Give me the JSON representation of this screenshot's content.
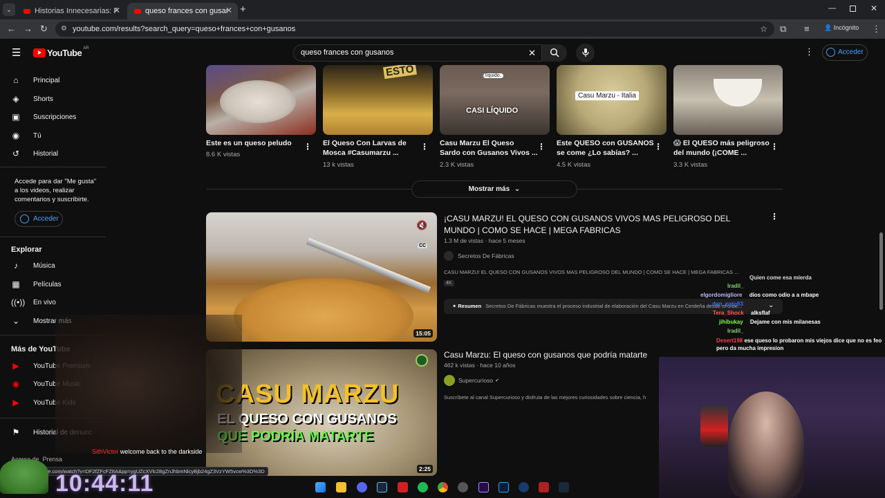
{
  "browser": {
    "tabs": [
      {
        "title": "Historias Innecesarias: Parasitos"
      },
      {
        "title": "queso frances con gusanos - You"
      }
    ],
    "url": "youtube.com/results?search_query=queso+frances+con+gusanos",
    "incognito_label": "Incógnito",
    "status_url": "he.com/watch?v=DF2fZFcFZ8A&pp=ygUZcXVlc28gZnJhbmNlcyBjb24gZ3VzYW5vcw%3D%3D"
  },
  "youtube": {
    "logo_text": "YouTube",
    "region": "AR",
    "search_value": "queso frances con gusanos",
    "sign_in": "Acceder"
  },
  "sidebar": {
    "main_items": [
      {
        "label": "Principal",
        "icon": "home-icon"
      },
      {
        "label": "Shorts",
        "icon": "shorts-icon"
      },
      {
        "label": "Suscripciones",
        "icon": "subscriptions-icon"
      },
      {
        "label": "Tú",
        "icon": "you-icon"
      },
      {
        "label": "Historial",
        "icon": "history-icon"
      }
    ],
    "promo_text": "Accede para dar \"Me gusta\" a los videos, realizar comentarios y suscribirte.",
    "promo_button": "Acceder",
    "explore_heading": "Explorar",
    "explore_items": [
      {
        "label": "Música",
        "icon": "music-icon"
      },
      {
        "label": "Películas",
        "icon": "movies-icon"
      },
      {
        "label": "En vivo",
        "icon": "live-icon"
      },
      {
        "label": "Mostrar más",
        "icon": "chevron-down-icon"
      }
    ],
    "more_heading": "Más de YouTube",
    "more_items": [
      {
        "label": "YouTube Premium"
      },
      {
        "label": "YouTube Music"
      },
      {
        "label": "YouTube Kids"
      }
    ],
    "report_history": "Historial de denunc",
    "footer_links": "Acerca de  Prensa"
  },
  "shorts_row": [
    {
      "title_line1": "Este es un queso peludo",
      "title_line2": "",
      "views": "8.6 K vistas",
      "overlay": ""
    },
    {
      "title_line1": "El Queso Con Larvas de",
      "title_line2": "Mosca #Casumarzu ...",
      "views": "13 k vistas",
      "overlay": "ESTO"
    },
    {
      "title_line1": "Casu Marzu  El Queso",
      "title_line2": "Sardo con Gusanos Vivos ...",
      "views": "2.3 K vistas",
      "overlay": "CASI LÍQUIDO"
    },
    {
      "title_line1": "Este QUESO con GUSANOS",
      "title_line2": "se come ¿Lo sabías? ...",
      "views": "4.5 K vistas",
      "overlay": "Casu Marzu - Italia"
    },
    {
      "title_line1": "😱 El QUESO más peligroso",
      "title_line2": "del mundo (¡COME ...",
      "views": "3.3 K vistas",
      "overlay": ""
    }
  ],
  "show_more": "Mostrar más",
  "results": [
    {
      "title": "¡CASU MARZU! EL QUESO CON GUSANOS VIVOS MAS PELIGROSO DEL MUNDO | COMO SE HACE | MEGA FABRICAS",
      "meta": "1.3 M de vistas · hace 5 meses",
      "channel": "Secretos De Fábricas",
      "description": "CASU MARZU! EL QUESO CON GUSANOS VIVOS MAS PELIGROSO DEL MUNDO | COMO SE HACE | MEGA FABRICAS ...",
      "badge": "4K",
      "summary_label": "Resumen",
      "summary": "Secretos De Fábricas muestra el proceso industrial de elaboración del Casu Marzu en Cerdeña desde el orde...",
      "duration": "15:05"
    },
    {
      "title": "Casu Marzu: El queso con gusanos que podría matarte",
      "meta": "462 k vistas · hace 10 años",
      "channel": "Supercurioso",
      "description": "Suscríbete al canal Supercurioso y disfruta de las mejores curiosidades sobre ciencia, h",
      "thumb_line1": "CASU MARZU",
      "thumb_line2": "EL QUESO CON GUSANOS",
      "thumb_line3": "QUE PODRÍA MATARTE",
      "duration": "2:25"
    }
  ],
  "stream_overlay": {
    "clock": "10:44:11",
    "alert_user": "SithVictor",
    "alert_text": "welcome back to the darkside",
    "chat": [
      {
        "user": "Iradil_",
        "text": "",
        "color": "#7fd36b"
      },
      {
        "user": "elgordomigliore",
        "text": "dios como odio a a mbape",
        "color": "#b9b9ff"
      },
      {
        "user": "don_pato93",
        "text": "",
        "color": "#3a6bff"
      },
      {
        "user": "Tera_Shock",
        "text": "alksflaf",
        "color": "#ff5757"
      },
      {
        "user": "jihibukay",
        "text": "Dejame con mis milanesas",
        "color": "#7cff4a"
      },
      {
        "user": "Iradil_",
        "text": "",
        "color": "#7fd36b"
      },
      {
        "user": "Desert198",
        "text": "ese queso lo probaron mis viejos dice que no es feo pero da mucha impresion",
        "color": "#ff4040"
      }
    ],
    "chat_top_text": "Quien come esa mierda"
  },
  "colors": {
    "yt_red": "#ff0000",
    "link_blue": "#3ea6ff",
    "bg": "#0f0f0f"
  }
}
